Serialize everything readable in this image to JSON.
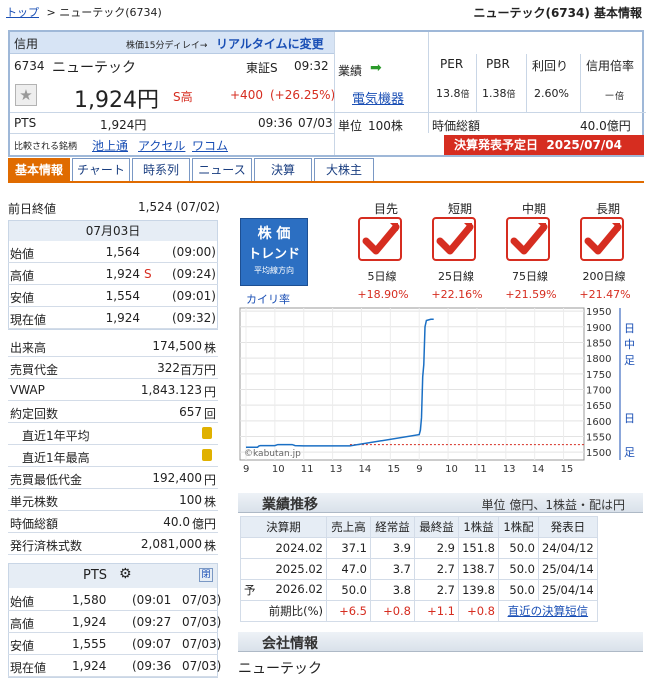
{
  "breadcrumb": {
    "top": "トップ",
    "sep": ">",
    "name": "ニューテック(6734)"
  },
  "page_title": "ニューテック(6734) 基本情報",
  "stock": {
    "market_type": "信用",
    "delay_note": "株価15分ディレイ→",
    "realtime_link": "リアルタイムに変更",
    "code": "6734",
    "name": "ニューテック",
    "exchange": "東証S",
    "time": "09:32",
    "price": "1,924円",
    "price_flag": "S高",
    "change": "+400",
    "change_pct": "(+26.25%)",
    "pts_label": "PTS",
    "pts_price": "1,924円",
    "pts_time": "09:36",
    "pts_date": "07/03",
    "related_label": "比較される銘柄",
    "related": [
      "池上通",
      "アクセル",
      "ワコム"
    ],
    "industry_label": "業績",
    "industry": "電気機器",
    "unit_label": "単位",
    "unit": "100株",
    "per_label": "PER",
    "per": "13.8",
    "per_unit": "倍",
    "pbr_label": "PBR",
    "pbr": "1.38",
    "pbr_unit": "倍",
    "yield_label": "利回り",
    "yield": "2.60%",
    "margin_label": "信用倍率",
    "margin": "－",
    "margin_unit": "倍",
    "cap_label": "時価総額",
    "cap": "40.0億円",
    "earnings_label": "決算発表予定日",
    "earnings_date": "2025/07/04",
    "colors": {
      "accent": "#e06b00",
      "border": "#9fb8d8",
      "red": "#d62d20",
      "link": "#1a4fb5",
      "earnings_bg": "#d62d20"
    }
  },
  "tabs": [
    "基本情報",
    "チャート",
    "時系列",
    "ニュース",
    "決算",
    "大株主"
  ],
  "prev_close": {
    "label": "前日終値",
    "value": "1,524",
    "date": "(07/02)"
  },
  "day": {
    "date": "07月03日",
    "rows": [
      {
        "k": "始値",
        "v": "1,564",
        "flag": "",
        "t": "(09:00)"
      },
      {
        "k": "高値",
        "v": "1,924",
        "flag": "S",
        "t": "(09:24)"
      },
      {
        "k": "安値",
        "v": "1,554",
        "flag": "",
        "t": "(09:01)"
      },
      {
        "k": "現在値",
        "v": "1,924",
        "flag": "",
        "t": "(09:32)"
      }
    ]
  },
  "stats": [
    {
      "k": "出来高",
      "v": "174,500",
      "u": "株",
      "lock": false,
      "indent": false
    },
    {
      "k": "売買代金",
      "v": "322",
      "u": "百万円",
      "lock": false,
      "indent": false
    },
    {
      "k": "VWAP",
      "v": "1,843.123",
      "u": "円",
      "lock": false,
      "indent": false
    },
    {
      "k": "約定回数",
      "v": "657",
      "u": "回",
      "lock": false,
      "indent": false
    },
    {
      "k": "直近1年平均",
      "v": "",
      "u": "",
      "lock": true,
      "indent": true
    },
    {
      "k": "直近1年最高",
      "v": "",
      "u": "",
      "lock": true,
      "indent": true
    },
    {
      "k": "売買最低代金",
      "v": "192,400",
      "u": "円",
      "lock": false,
      "indent": false
    },
    {
      "k": "単元株数",
      "v": "100",
      "u": "株",
      "lock": false,
      "indent": false
    },
    {
      "k": "時価総額",
      "v": "40.0",
      "u": "億円",
      "lock": false,
      "indent": false
    },
    {
      "k": "発行済株式数",
      "v": "2,081,000",
      "u": "株",
      "lock": false,
      "indent": false
    }
  ],
  "pts": {
    "title": "PTS",
    "close_label": "閉",
    "rows": [
      {
        "k": "始値",
        "v": "1,580",
        "t": "(09:01",
        "d": "07/03)"
      },
      {
        "k": "高値",
        "v": "1,924",
        "t": "(09:27",
        "d": "07/03)"
      },
      {
        "k": "安値",
        "v": "1,555",
        "t": "(09:07",
        "d": "07/03)"
      },
      {
        "k": "現在値",
        "v": "1,924",
        "t": "(09:36",
        "d": "07/03)"
      }
    ]
  },
  "trend": {
    "badge_l1": "株 価",
    "badge_l2": "トレンド",
    "badge_l3": "平均線方向",
    "kairi_label": "カイリ率",
    "items": [
      {
        "head": "目先",
        "line": "5日線",
        "pct": "+18.90%"
      },
      {
        "head": "短期",
        "line": "25日線",
        "pct": "+22.16%"
      },
      {
        "head": "中期",
        "line": "75日線",
        "pct": "+21.59%"
      },
      {
        "head": "長期",
        "line": "200日線",
        "pct": "+21.47%"
      }
    ]
  },
  "chart_data": {
    "type": "line",
    "watermark": "©kabutan.jp",
    "y_ticks": [
      1500,
      1550,
      1600,
      1650,
      1700,
      1750,
      1800,
      1850,
      1900,
      1950
    ],
    "ylim": [
      1475,
      1960
    ],
    "x_ticks": [
      "9",
      "10",
      "11",
      "13",
      "14",
      "15",
      "9",
      "10",
      "11",
      "13",
      "14",
      "15"
    ],
    "side_label_top": [
      "日",
      "中",
      "足"
    ],
    "side_label_bottom": [
      "日",
      "足"
    ],
    "prev_close": 1524,
    "series": [
      {
        "values": [
          [
            0,
            1516
          ],
          [
            0.4,
            1516
          ],
          [
            0.45,
            1520
          ],
          [
            0.5,
            1521
          ],
          [
            1.0,
            1521
          ],
          [
            1.1,
            1524
          ],
          [
            1.6,
            1524
          ],
          [
            1.7,
            1521
          ],
          [
            2.0,
            1520
          ],
          [
            2.6,
            1520
          ],
          [
            3.0,
            1520
          ],
          [
            3.6,
            1520
          ],
          [
            6.0,
            1556
          ],
          [
            6.04,
            1570
          ],
          [
            6.08,
            1610
          ],
          [
            6.12,
            1740
          ],
          [
            6.16,
            1780
          ],
          [
            6.2,
            1900
          ],
          [
            6.25,
            1920
          ],
          [
            6.4,
            1924
          ],
          [
            6.5,
            1924
          ]
        ]
      }
    ]
  },
  "financials": {
    "title": "業績推移",
    "unit_note": "単位 億円、1株益・配は円",
    "headers": [
      "決算期",
      "売上高",
      "経常益",
      "最終益",
      "1株益",
      "1株配",
      "発表日"
    ],
    "rows": [
      [
        "",
        "2024.02",
        "37.1",
        "3.9",
        "2.9",
        "151.8",
        "50.0",
        "24/04/12"
      ],
      [
        "",
        "2025.02",
        "47.0",
        "3.7",
        "2.7",
        "138.7",
        "50.0",
        "25/04/14"
      ],
      [
        "予",
        "2026.02",
        "50.0",
        "3.8",
        "2.7",
        "139.8",
        "50.0",
        "25/04/14"
      ]
    ],
    "yoy_label": "前期比(%)",
    "yoy": [
      "+6.5",
      "+0.8",
      "+1.1",
      "+0.8"
    ],
    "recent_link": "直近の決算短信"
  },
  "company": {
    "title": "会社情報",
    "name": "ニューテック"
  }
}
